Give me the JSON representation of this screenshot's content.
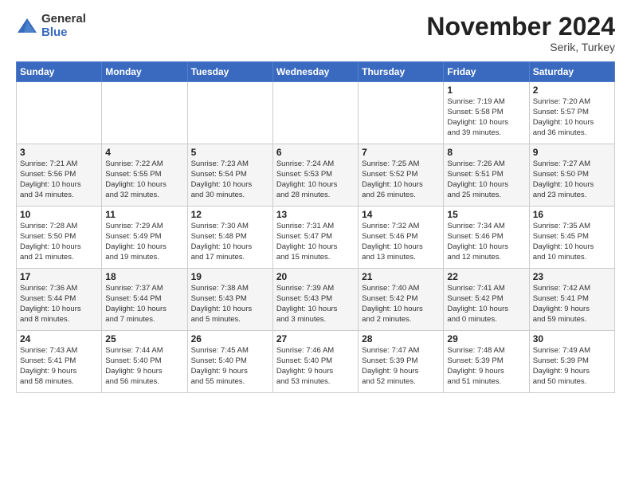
{
  "header": {
    "logo_general": "General",
    "logo_blue": "Blue",
    "month_title": "November 2024",
    "location": "Serik, Turkey"
  },
  "weekdays": [
    "Sunday",
    "Monday",
    "Tuesday",
    "Wednesday",
    "Thursday",
    "Friday",
    "Saturday"
  ],
  "weeks": [
    [
      {
        "day": "",
        "info": ""
      },
      {
        "day": "",
        "info": ""
      },
      {
        "day": "",
        "info": ""
      },
      {
        "day": "",
        "info": ""
      },
      {
        "day": "",
        "info": ""
      },
      {
        "day": "1",
        "info": "Sunrise: 7:19 AM\nSunset: 5:58 PM\nDaylight: 10 hours\nand 39 minutes."
      },
      {
        "day": "2",
        "info": "Sunrise: 7:20 AM\nSunset: 5:57 PM\nDaylight: 10 hours\nand 36 minutes."
      }
    ],
    [
      {
        "day": "3",
        "info": "Sunrise: 7:21 AM\nSunset: 5:56 PM\nDaylight: 10 hours\nand 34 minutes."
      },
      {
        "day": "4",
        "info": "Sunrise: 7:22 AM\nSunset: 5:55 PM\nDaylight: 10 hours\nand 32 minutes."
      },
      {
        "day": "5",
        "info": "Sunrise: 7:23 AM\nSunset: 5:54 PM\nDaylight: 10 hours\nand 30 minutes."
      },
      {
        "day": "6",
        "info": "Sunrise: 7:24 AM\nSunset: 5:53 PM\nDaylight: 10 hours\nand 28 minutes."
      },
      {
        "day": "7",
        "info": "Sunrise: 7:25 AM\nSunset: 5:52 PM\nDaylight: 10 hours\nand 26 minutes."
      },
      {
        "day": "8",
        "info": "Sunrise: 7:26 AM\nSunset: 5:51 PM\nDaylight: 10 hours\nand 25 minutes."
      },
      {
        "day": "9",
        "info": "Sunrise: 7:27 AM\nSunset: 5:50 PM\nDaylight: 10 hours\nand 23 minutes."
      }
    ],
    [
      {
        "day": "10",
        "info": "Sunrise: 7:28 AM\nSunset: 5:50 PM\nDaylight: 10 hours\nand 21 minutes."
      },
      {
        "day": "11",
        "info": "Sunrise: 7:29 AM\nSunset: 5:49 PM\nDaylight: 10 hours\nand 19 minutes."
      },
      {
        "day": "12",
        "info": "Sunrise: 7:30 AM\nSunset: 5:48 PM\nDaylight: 10 hours\nand 17 minutes."
      },
      {
        "day": "13",
        "info": "Sunrise: 7:31 AM\nSunset: 5:47 PM\nDaylight: 10 hours\nand 15 minutes."
      },
      {
        "day": "14",
        "info": "Sunrise: 7:32 AM\nSunset: 5:46 PM\nDaylight: 10 hours\nand 13 minutes."
      },
      {
        "day": "15",
        "info": "Sunrise: 7:34 AM\nSunset: 5:46 PM\nDaylight: 10 hours\nand 12 minutes."
      },
      {
        "day": "16",
        "info": "Sunrise: 7:35 AM\nSunset: 5:45 PM\nDaylight: 10 hours\nand 10 minutes."
      }
    ],
    [
      {
        "day": "17",
        "info": "Sunrise: 7:36 AM\nSunset: 5:44 PM\nDaylight: 10 hours\nand 8 minutes."
      },
      {
        "day": "18",
        "info": "Sunrise: 7:37 AM\nSunset: 5:44 PM\nDaylight: 10 hours\nand 7 minutes."
      },
      {
        "day": "19",
        "info": "Sunrise: 7:38 AM\nSunset: 5:43 PM\nDaylight: 10 hours\nand 5 minutes."
      },
      {
        "day": "20",
        "info": "Sunrise: 7:39 AM\nSunset: 5:43 PM\nDaylight: 10 hours\nand 3 minutes."
      },
      {
        "day": "21",
        "info": "Sunrise: 7:40 AM\nSunset: 5:42 PM\nDaylight: 10 hours\nand 2 minutes."
      },
      {
        "day": "22",
        "info": "Sunrise: 7:41 AM\nSunset: 5:42 PM\nDaylight: 10 hours\nand 0 minutes."
      },
      {
        "day": "23",
        "info": "Sunrise: 7:42 AM\nSunset: 5:41 PM\nDaylight: 9 hours\nand 59 minutes."
      }
    ],
    [
      {
        "day": "24",
        "info": "Sunrise: 7:43 AM\nSunset: 5:41 PM\nDaylight: 9 hours\nand 58 minutes."
      },
      {
        "day": "25",
        "info": "Sunrise: 7:44 AM\nSunset: 5:40 PM\nDaylight: 9 hours\nand 56 minutes."
      },
      {
        "day": "26",
        "info": "Sunrise: 7:45 AM\nSunset: 5:40 PM\nDaylight: 9 hours\nand 55 minutes."
      },
      {
        "day": "27",
        "info": "Sunrise: 7:46 AM\nSunset: 5:40 PM\nDaylight: 9 hours\nand 53 minutes."
      },
      {
        "day": "28",
        "info": "Sunrise: 7:47 AM\nSunset: 5:39 PM\nDaylight: 9 hours\nand 52 minutes."
      },
      {
        "day": "29",
        "info": "Sunrise: 7:48 AM\nSunset: 5:39 PM\nDaylight: 9 hours\nand 51 minutes."
      },
      {
        "day": "30",
        "info": "Sunrise: 7:49 AM\nSunset: 5:39 PM\nDaylight: 9 hours\nand 50 minutes."
      }
    ]
  ]
}
